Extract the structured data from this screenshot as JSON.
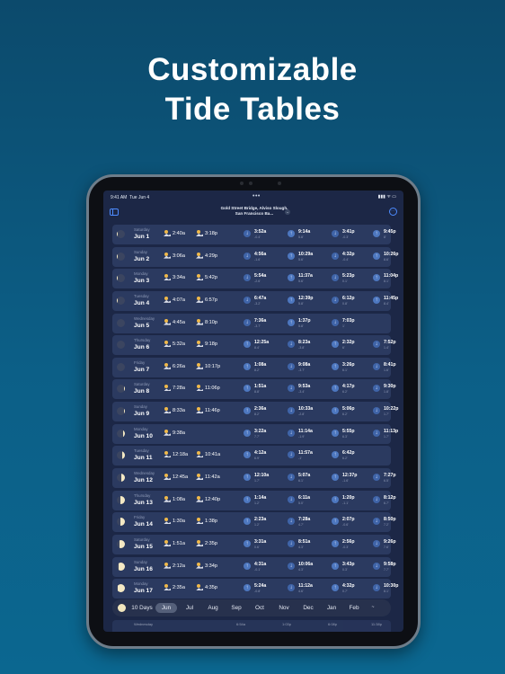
{
  "headline": {
    "line1": "Customizable",
    "line2": "Tide Tables"
  },
  "status_bar": {
    "time": "9:41 AM",
    "date": "Tue Jun 4",
    "dots": "•••",
    "icons": "▮▮▮ ᯤ ▭"
  },
  "nav": {
    "station": "Gold Street Bridge, Alviso Slough, San Francisco Ba...",
    "station_chevron": "⌄",
    "more_icon": "⋯"
  },
  "rows": [
    {
      "day": "Saturday",
      "date": "Jun 1",
      "moon": 0.12,
      "moon_side": "left",
      "rise": "2:40a",
      "set": "3:18p",
      "tides": [
        {
          "dir": "down",
          "time": "3:52a",
          "h": "-0.4'"
        },
        {
          "dir": "up",
          "time": "9:14a",
          "h": "5.8'"
        },
        {
          "dir": "down",
          "time": "3:41p",
          "h": "-0.3'"
        },
        {
          "dir": "up",
          "time": "9:45p",
          "h": "8'"
        }
      ]
    },
    {
      "day": "Sunday",
      "date": "Jun 2",
      "moon": 0.08,
      "moon_side": "left",
      "rise": "3:06a",
      "set": "4:29p",
      "tides": [
        {
          "dir": "down",
          "time": "4:56a",
          "h": "-1.6'"
        },
        {
          "dir": "up",
          "time": "10:29a",
          "h": "5.6'"
        },
        {
          "dir": "down",
          "time": "4:32p",
          "h": "-0.4'"
        },
        {
          "dir": "up",
          "time": "10:26p",
          "h": "8.6'"
        }
      ]
    },
    {
      "day": "Monday",
      "date": "Jun 3",
      "moon": 0.05,
      "moon_side": "left",
      "rise": "3:34a",
      "set": "5:42p",
      "tides": [
        {
          "dir": "down",
          "time": "5:54a",
          "h": "-2.6'"
        },
        {
          "dir": "up",
          "time": "11:37a",
          "h": "5.6'"
        },
        {
          "dir": "down",
          "time": "5:23p",
          "h": "0.1'"
        },
        {
          "dir": "up",
          "time": "11:04p",
          "h": "8.1'"
        }
      ]
    },
    {
      "day": "Tuesday",
      "date": "Jun 4",
      "moon": 0.02,
      "moon_side": "left",
      "rise": "4:07a",
      "set": "6:57p",
      "tides": [
        {
          "dir": "down",
          "time": "6:47a",
          "h": "-3.2'"
        },
        {
          "dir": "up",
          "time": "12:39p",
          "h": "5.8'"
        },
        {
          "dir": "down",
          "time": "6:12p",
          "h": "0.8'"
        },
        {
          "dir": "up",
          "time": "11:45p",
          "h": "8.4'"
        }
      ]
    },
    {
      "day": "Wednesday",
      "date": "Jun 5",
      "moon": 0.0,
      "moon_side": "left",
      "rise": "4:45a",
      "set": "8:10p",
      "tides": [
        {
          "dir": "down",
          "time": "7:36a",
          "h": "-3.7'"
        },
        {
          "dir": "up",
          "time": "1:37p",
          "h": "5.8'"
        },
        {
          "dir": "down",
          "time": "7:03p",
          "h": "1'"
        },
        {
          "dir": "",
          "time": "",
          "h": ""
        }
      ]
    },
    {
      "day": "Thursday",
      "date": "Jun 6",
      "moon": 0.02,
      "moon_side": "right",
      "rise": "5:32a",
      "set": "9:18p",
      "tides": [
        {
          "dir": "up",
          "time": "12:25a",
          "h": "8.4'"
        },
        {
          "dir": "down",
          "time": "8:23a",
          "h": "-3.8'"
        },
        {
          "dir": "up",
          "time": "2:32p",
          "h": "6'"
        },
        {
          "dir": "down",
          "time": "7:52p",
          "h": "1.4'"
        }
      ]
    },
    {
      "day": "Friday",
      "date": "Jun 7",
      "moon": 0.05,
      "moon_side": "right",
      "rise": "6:26a",
      "set": "10:17p",
      "tides": [
        {
          "dir": "up",
          "time": "1:08a",
          "h": "8.2'"
        },
        {
          "dir": "down",
          "time": "9:08a",
          "h": "-3.7'"
        },
        {
          "dir": "up",
          "time": "3:26p",
          "h": "6.1'"
        },
        {
          "dir": "down",
          "time": "8:41p",
          "h": "1.6'"
        }
      ]
    },
    {
      "day": "Saturday",
      "date": "Jun 8",
      "moon": 0.1,
      "moon_side": "right",
      "rise": "7:28a",
      "set": "11:06p",
      "tides": [
        {
          "dir": "up",
          "time": "1:51a",
          "h": "8.8'"
        },
        {
          "dir": "down",
          "time": "9:53a",
          "h": "-3.4'"
        },
        {
          "dir": "up",
          "time": "4:17p",
          "h": "6.2'"
        },
        {
          "dir": "down",
          "time": "9:30p",
          "h": "1.8'"
        }
      ]
    },
    {
      "day": "Sunday",
      "date": "Jun 9",
      "moon": 0.16,
      "moon_side": "right",
      "rise": "8:33a",
      "set": "11:46p",
      "tides": [
        {
          "dir": "up",
          "time": "2:36a",
          "h": "8.2'"
        },
        {
          "dir": "down",
          "time": "10:33a",
          "h": "-2.8'"
        },
        {
          "dir": "up",
          "time": "5:06p",
          "h": "6.2'"
        },
        {
          "dir": "down",
          "time": "10:22p",
          "h": "1.7'"
        }
      ]
    },
    {
      "day": "Monday",
      "date": "Jun 10",
      "moon": 0.24,
      "moon_side": "right",
      "rise": "9:38a",
      "set": "",
      "tides": [
        {
          "dir": "up",
          "time": "3:22a",
          "h": "7.7'"
        },
        {
          "dir": "down",
          "time": "11:14a",
          "h": "-1.9'"
        },
        {
          "dir": "up",
          "time": "5:55p",
          "h": "6.3'"
        },
        {
          "dir": "down",
          "time": "11:13p",
          "h": "1.7'"
        }
      ]
    },
    {
      "day": "Tuesday",
      "date": "Jun 11",
      "moon": 0.32,
      "moon_side": "right",
      "rise": "12:18a",
      "set": "10:41a",
      "tides": [
        {
          "dir": "up",
          "time": "4:12a",
          "h": "6.9'"
        },
        {
          "dir": "down",
          "time": "11:57a",
          "h": "-1'"
        },
        {
          "dir": "up",
          "time": "6:42p",
          "h": "6.2'"
        },
        {
          "dir": "",
          "time": "",
          "h": ""
        }
      ]
    },
    {
      "day": "Wednesday",
      "date": "Jun 12",
      "moon": 0.42,
      "moon_side": "right",
      "rise": "12:45a",
      "set": "11:42a",
      "tides": [
        {
          "dir": "up",
          "time": "12:10a",
          "h": "1.7'"
        },
        {
          "dir": "down",
          "time": "5:07a",
          "h": "6.1'"
        },
        {
          "dir": "up",
          "time": "12:37p",
          "h": "-1.6'"
        },
        {
          "dir": "down",
          "time": "7:27p",
          "h": "6.5'"
        }
      ]
    },
    {
      "day": "Thursday",
      "date": "Jun 13",
      "moon": 0.52,
      "moon_side": "right",
      "rise": "1:08a",
      "set": "12:40p",
      "tides": [
        {
          "dir": "up",
          "time": "1:14a",
          "h": "1.2'"
        },
        {
          "dir": "down",
          "time": "6:11a",
          "h": "5.0'"
        },
        {
          "dir": "up",
          "time": "1:20p",
          "h": "-1.1'"
        },
        {
          "dir": "down",
          "time": "8:12p",
          "h": "6.7'"
        }
      ]
    },
    {
      "day": "Friday",
      "date": "Jun 14",
      "moon": 0.6,
      "moon_side": "right",
      "rise": "1:30a",
      "set": "1:38p",
      "tides": [
        {
          "dir": "up",
          "time": "2:23a",
          "h": "1.2'"
        },
        {
          "dir": "down",
          "time": "7:28a",
          "h": "4.7'"
        },
        {
          "dir": "up",
          "time": "2:07p",
          "h": "-0.6'"
        },
        {
          "dir": "down",
          "time": "8:50p",
          "h": "7.2'"
        }
      ]
    },
    {
      "day": "Saturday",
      "date": "Jun 15",
      "moon": 0.7,
      "moon_side": "right",
      "rise": "1:51a",
      "set": "2:35p",
      "tides": [
        {
          "dir": "up",
          "time": "3:31a",
          "h": "0.6'"
        },
        {
          "dir": "down",
          "time": "8:51a",
          "h": "4.3'"
        },
        {
          "dir": "up",
          "time": "2:56p",
          "h": "-0.3'"
        },
        {
          "dir": "down",
          "time": "9:26p",
          "h": "7.6'"
        }
      ]
    },
    {
      "day": "Sunday",
      "date": "Jun 16",
      "moon": 0.8,
      "moon_side": "right",
      "rise": "2:12a",
      "set": "3:34p",
      "tides": [
        {
          "dir": "up",
          "time": "4:31a",
          "h": "-0.1'"
        },
        {
          "dir": "down",
          "time": "10:06a",
          "h": "4.3'"
        },
        {
          "dir": "up",
          "time": "3:43p",
          "h": "0.3'"
        },
        {
          "dir": "down",
          "time": "9:58p",
          "h": "7.7'"
        }
      ]
    },
    {
      "day": "Monday",
      "date": "Jun 17",
      "moon": 0.88,
      "moon_side": "right",
      "rise": "2:35a",
      "set": "4:35p",
      "tides": [
        {
          "dir": "up",
          "time": "5:24a",
          "h": "-0.8'"
        },
        {
          "dir": "down",
          "time": "11:12a",
          "h": "4.6'"
        },
        {
          "dir": "up",
          "time": "4:32p",
          "h": "0.7'"
        },
        {
          "dir": "down",
          "time": "10:30p",
          "h": "8.1'"
        }
      ]
    }
  ],
  "month_bar": {
    "tabs": [
      "10 Days",
      "Jun",
      "Jul",
      "Aug",
      "Sep",
      "Oct",
      "Nov",
      "Dec",
      "Jan",
      "Feb"
    ],
    "selected": "Jun",
    "trailing": "~"
  },
  "peek": {
    "day": "Wednesday",
    "time1": "6:54a",
    "time2": "1:03p",
    "time3": "6:08p",
    "time4": "11:38p"
  }
}
